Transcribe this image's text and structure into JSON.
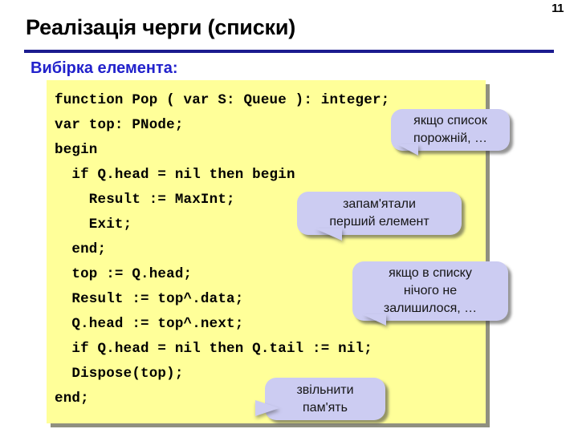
{
  "slide": {
    "page_number": "11",
    "title": "Реалізація черги (списки)",
    "subtitle": "Вибірка елемента:",
    "rule_color": "#1b1b8f",
    "subtitle_color": "#2222cc",
    "code_bg_color": "#ffff99",
    "callout_bg_color": "#ccccf2"
  },
  "code": {
    "lines": [
      "function Pop ( var S: Queue ): integer;",
      "var top: PNode;",
      "begin",
      "  if Q.head = nil then begin",
      "    Result := MaxInt;",
      "    Exit;",
      "  end;",
      "  top := Q.head;",
      "  Result := top^.data;",
      "  Q.head := top^.next;",
      "  if Q.head = nil then Q.tail := nil;",
      "  Dispose(top);",
      "end;"
    ]
  },
  "callouts": [
    {
      "id": "empty-list",
      "lines": [
        "якщо список",
        "порожній, …"
      ]
    },
    {
      "id": "saved-first-element",
      "lines": [
        "запам'ятали",
        "перший елемент"
      ]
    },
    {
      "id": "nothing-left",
      "lines": [
        "якщо в списку",
        "нічого не",
        "залишилося, …"
      ]
    },
    {
      "id": "free-memory",
      "lines": [
        "звільнити",
        "пам'ять"
      ]
    }
  ]
}
